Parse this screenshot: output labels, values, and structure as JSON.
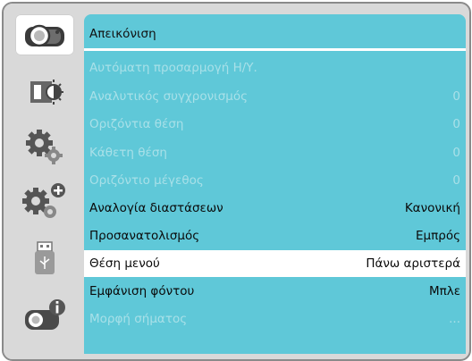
{
  "menu": {
    "title": "Απεικόνιση",
    "items": [
      {
        "label": "Αυτόματη προσαρμογή Η/Υ.",
        "value": "",
        "state": "disabled"
      },
      {
        "label": "Αναλυτικός συγχρονισμός",
        "value": "0",
        "state": "disabled"
      },
      {
        "label": "Οριζόντια θέση",
        "value": "0",
        "state": "disabled"
      },
      {
        "label": "Κάθετη θέση",
        "value": "0",
        "state": "disabled"
      },
      {
        "label": "Οριζόντιο μέγεθος",
        "value": "0",
        "state": "disabled"
      },
      {
        "label": "Αναλογία διαστάσεων",
        "value": "Κανονική",
        "state": "enabled"
      },
      {
        "label": "Προσανατολισμός",
        "value": "Εμπρός",
        "state": "enabled"
      },
      {
        "label": "Θέση μενού",
        "value": "Πάνω αριστερά",
        "state": "selected"
      },
      {
        "label": "Εμφάνιση φόντου",
        "value": "Μπλε",
        "state": "enabled"
      },
      {
        "label": "Μορφή σήματος",
        "value": "...",
        "state": "disabled"
      }
    ]
  },
  "sidebar": {
    "tabs": [
      {
        "icon": "projector-icon",
        "selected": true
      },
      {
        "icon": "picture-brightness-icon",
        "selected": false
      },
      {
        "icon": "settings-gear-icon",
        "selected": false
      },
      {
        "icon": "extended-settings-gear-icon",
        "selected": false
      },
      {
        "icon": "usb-icon",
        "selected": false
      },
      {
        "icon": "projector-info-icon",
        "selected": false
      }
    ]
  },
  "colors": {
    "panel": "#5fc8d8",
    "sidebar": "#d9d9d9",
    "selected_row": "#ffffff",
    "disabled_text": "#a8e0e8"
  }
}
